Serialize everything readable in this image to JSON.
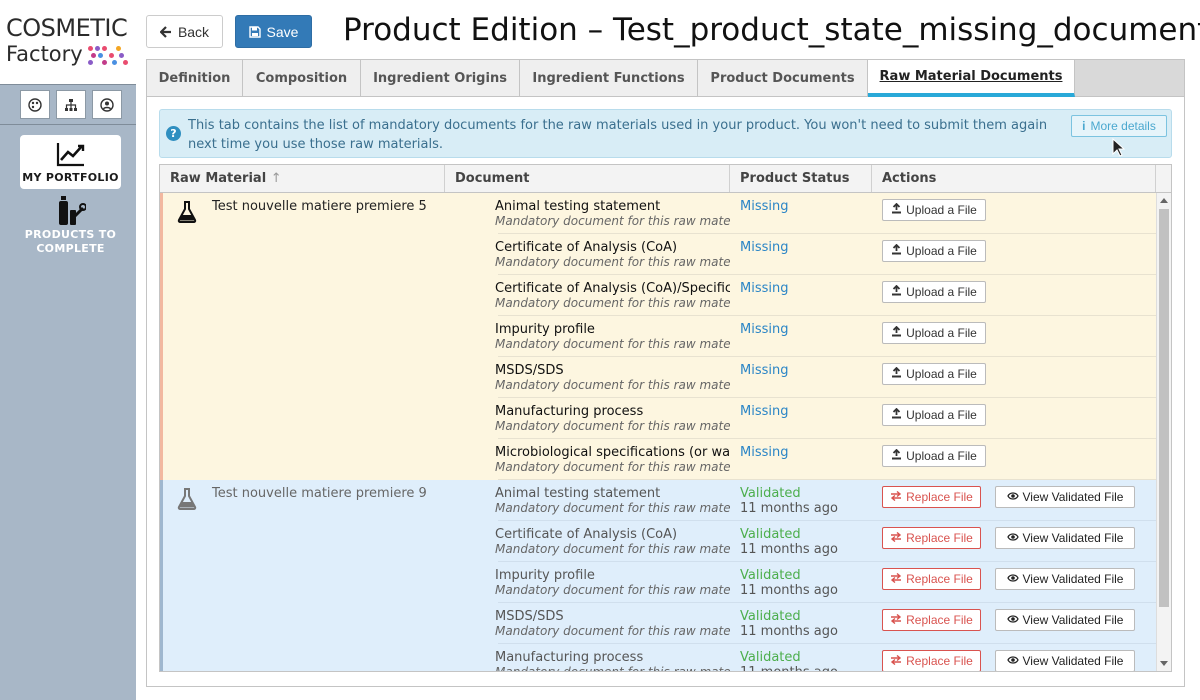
{
  "brand": {
    "line1": "COSMETIC",
    "line2": "Factory"
  },
  "nav": {
    "portfolio": "MY PORTFOLIO",
    "products_line1": "PRODUCTS TO",
    "products_line2": "COMPLETE"
  },
  "toolbar": {
    "back": "Back",
    "save": "Save"
  },
  "title": "Product Edition – Test_product_state_missing_document",
  "tabs": [
    {
      "label": "Definition"
    },
    {
      "label": "Composition"
    },
    {
      "label": "Ingredient Origins"
    },
    {
      "label": "Ingredient Functions"
    },
    {
      "label": "Product Documents"
    },
    {
      "label": "Raw Material Documents"
    }
  ],
  "active_tab": "Raw Material Documents",
  "info": {
    "text": "This tab contains the list of mandatory documents for the raw materials used in your product. You won't need to submit them again next time you use those raw materials.",
    "more_details": "More details"
  },
  "table": {
    "columns": [
      "Raw Material",
      "Document",
      "Product Status",
      "Actions"
    ],
    "sort_indicator": "↑",
    "doc_subtitle": "Mandatory document for this raw mater",
    "upload_label": "Upload a File",
    "replace_label": "Replace File",
    "view_label": "View Validated File",
    "groups": [
      {
        "raw_material": "Test nouvelle matiere premiere 5",
        "state": "missing",
        "rows": [
          {
            "document": "Animal testing statement",
            "status": "Missing"
          },
          {
            "document": "Certificate of Analysis (CoA)",
            "status": "Missing"
          },
          {
            "document": "Certificate of Analysis (CoA)/Specific",
            "status": "Missing"
          },
          {
            "document": "Impurity profile",
            "status": "Missing"
          },
          {
            "document": "MSDS/SDS",
            "status": "Missing"
          },
          {
            "document": "Manufacturing process",
            "status": "Missing"
          },
          {
            "document": "Microbiological specifications (or wa",
            "status": "Missing"
          }
        ]
      },
      {
        "raw_material": "Test nouvelle matiere premiere 9",
        "state": "validated",
        "rows": [
          {
            "document": "Animal testing statement",
            "status": "Validated",
            "when": "11 months ago"
          },
          {
            "document": "Certificate of Analysis (CoA)",
            "status": "Validated",
            "when": "11 months ago"
          },
          {
            "document": "Impurity profile",
            "status": "Validated",
            "when": "11 months ago"
          },
          {
            "document": "MSDS/SDS",
            "status": "Validated",
            "when": "11 months ago"
          },
          {
            "document": "Manufacturing process",
            "status": "Validated",
            "when": "11 months ago"
          }
        ]
      }
    ]
  },
  "colors": {
    "sidebar": "#a8b7c7",
    "primary": "#337ab7",
    "tab_accent": "#29a9d8",
    "missing_bg": "#fdf6e0",
    "validated_bg": "#dfeefb",
    "missing_text": "#2a85c6",
    "validated_text": "#4cae4c",
    "danger": "#d9534f"
  },
  "icons": {
    "back": "arrow-left-icon",
    "save": "floppy-disk-icon",
    "portfolio": "line-chart-icon",
    "products": "bottles-wrench-icon",
    "raw_material": "flask-icon",
    "upload": "upload-icon",
    "replace": "exchange-icon",
    "view": "eye-icon",
    "help": "question-circle-icon",
    "info": "info-icon"
  }
}
